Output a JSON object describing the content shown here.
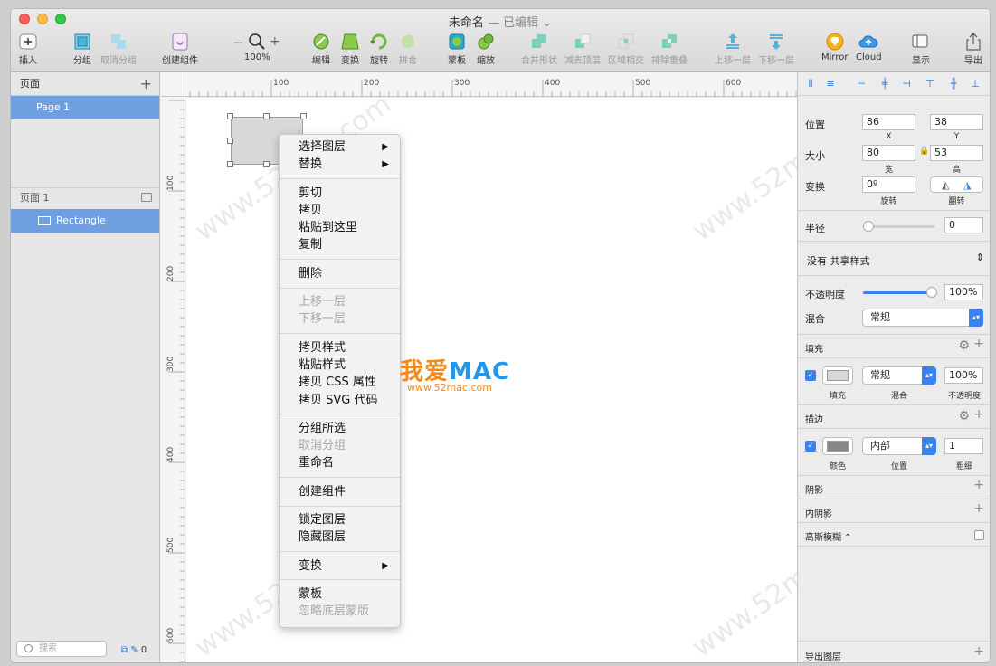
{
  "window": {
    "title": "未命名",
    "subtitle": "— 已编辑 ⌄"
  },
  "toolbar": {
    "insert": "插入",
    "group": "分组",
    "ungroup": "取消分组",
    "create_component": "创建组件",
    "zoom_minus": "−",
    "zoom_plus": "+",
    "zoom": "100%",
    "edit": "编辑",
    "transform": "变换",
    "rotate": "旋转",
    "combine": "拼合",
    "mask": "蒙板",
    "scale": "缩放",
    "union": "合并形状",
    "subtract": "减去顶层",
    "intersect": "区域相交",
    "difference": "排除重叠",
    "forward": "上移一层",
    "backward": "下移一层",
    "mirror": "Mirror",
    "cloud": "Cloud",
    "view": "显示",
    "export": "导出"
  },
  "pages_panel": {
    "header": "页面",
    "page": "Page 1",
    "layers_header": "页面 1",
    "layer": "Rectangle",
    "search_placeholder": "搜索",
    "count": "0"
  },
  "ruler": {
    "top": [
      "100",
      "200",
      "300",
      "400",
      "500",
      "600"
    ],
    "left": [
      "100",
      "200",
      "300",
      "400",
      "500",
      "600"
    ]
  },
  "context_menu": [
    [
      {
        "label": "选择图层",
        "arrow": true
      },
      {
        "label": "替换",
        "arrow": true
      }
    ],
    [
      {
        "label": "剪切"
      },
      {
        "label": "拷贝"
      },
      {
        "label": "粘贴到这里"
      },
      {
        "label": "复制"
      }
    ],
    [
      {
        "label": "删除"
      }
    ],
    [
      {
        "label": "上移一层",
        "disabled": true
      },
      {
        "label": "下移一层",
        "disabled": true
      }
    ],
    [
      {
        "label": "拷贝样式"
      },
      {
        "label": "粘贴样式"
      },
      {
        "label": "拷贝 CSS 属性"
      },
      {
        "label": "拷贝 SVG 代码"
      }
    ],
    [
      {
        "label": "分组所选"
      },
      {
        "label": "取消分组",
        "disabled": true
      },
      {
        "label": "重命名"
      }
    ],
    [
      {
        "label": "创建组件"
      }
    ],
    [
      {
        "label": "锁定图层"
      },
      {
        "label": "隐藏图层"
      }
    ],
    [
      {
        "label": "变换",
        "arrow": true
      }
    ],
    [
      {
        "label": "蒙板"
      },
      {
        "label": "忽略底层蒙版",
        "disabled": true
      }
    ]
  ],
  "watermark": {
    "logo_cn": "我爱",
    "logo_mac": "MAC",
    "url": "www.52mac.com",
    "tile": "www.52mac.com"
  },
  "inspector": {
    "position_label": "位置",
    "x": "86",
    "y": "38",
    "x_label": "X",
    "y_label": "Y",
    "size_label": "大小",
    "width": "80",
    "height": "53",
    "w_label": "宽",
    "h_label": "高",
    "transform_label": "变换",
    "rotation": "0º",
    "rotation_label": "旋转",
    "flip_label": "翻转",
    "radius_label": "半径",
    "radius": "0",
    "shared_style": "没有 共享样式",
    "opacity_label": "不透明度",
    "opacity": "100%",
    "blend_label": "混合",
    "blend": "常规",
    "fill_section": "填充",
    "fill_blend": "常规",
    "fill_opacity": "100%",
    "fill_cap_fill": "填充",
    "fill_cap_blend": "混合",
    "fill_cap_opacity": "不透明度",
    "border_section": "描边",
    "border_position": "内部",
    "border_width": "1",
    "border_cap_color": "颜色",
    "border_cap_position": "位置",
    "border_cap_width": "粗细",
    "shadow": "阴影",
    "inner_shadow": "内阴影",
    "blur": "高斯模糊 ⌃",
    "export": "导出图层"
  },
  "colors": {
    "accent": "#3a83ec",
    "selection": "#6f9fe0",
    "fill_swatch": "#d8d8d8",
    "border_swatch": "#888888"
  }
}
